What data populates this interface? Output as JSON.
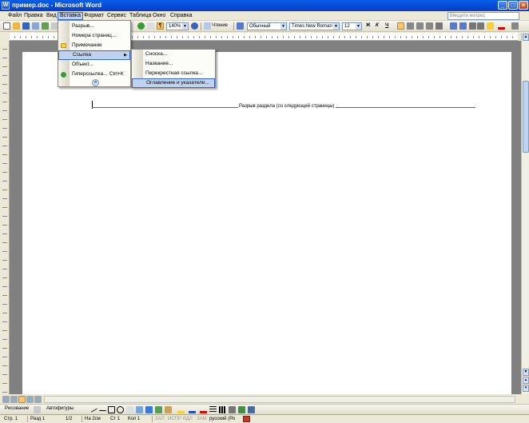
{
  "window": {
    "title": "пример.doc - Microsoft Word",
    "app_icon": "W"
  },
  "menubar": {
    "items": [
      "Файл",
      "Правка",
      "Вид",
      "Вставка",
      "Формат",
      "Сервис",
      "Таблица",
      "Окно",
      "Справка"
    ],
    "help_placeholder": "Введите вопрос"
  },
  "toolbar": {
    "zoom": "140%",
    "read_label": "Чтение",
    "style": "Обычный",
    "font": "Times New Roman",
    "size": "12",
    "bold": "Ж",
    "italic": "К",
    "underline": "Ч"
  },
  "insert_menu": {
    "items": [
      {
        "label": "Разрыв...",
        "shortcut": ""
      },
      {
        "label": "Номера страниц...",
        "shortcut": ""
      },
      {
        "label": "Примечание",
        "shortcut": ""
      },
      {
        "label": "Ссылка",
        "shortcut": ""
      },
      {
        "label": "Объект...",
        "shortcut": ""
      },
      {
        "label": "Гиперссылка...",
        "shortcut": "Ctrl+K"
      }
    ],
    "expand_label": "»"
  },
  "reference_submenu": {
    "items": [
      "Сноска...",
      "Название...",
      "Перекрестная ссылка...",
      "Оглавление и указатели..."
    ]
  },
  "document": {
    "section_break": "Разрыв раздела (со следующей страницы)"
  },
  "drawing_toolbar": {
    "draw_label": "Рисование",
    "autoshapes_label": "Автофигуры"
  },
  "status": {
    "page": "Стр. 1",
    "section": "Разд 1",
    "pages": "1/2",
    "at": "На 2см",
    "line": "Ст 1",
    "col": "Кол 1",
    "rec": "ЗАП",
    "trk": "ИСПР",
    "ext": "ВДЛ",
    "ovr": "ЗАМ",
    "language": "русский (Ро"
  }
}
